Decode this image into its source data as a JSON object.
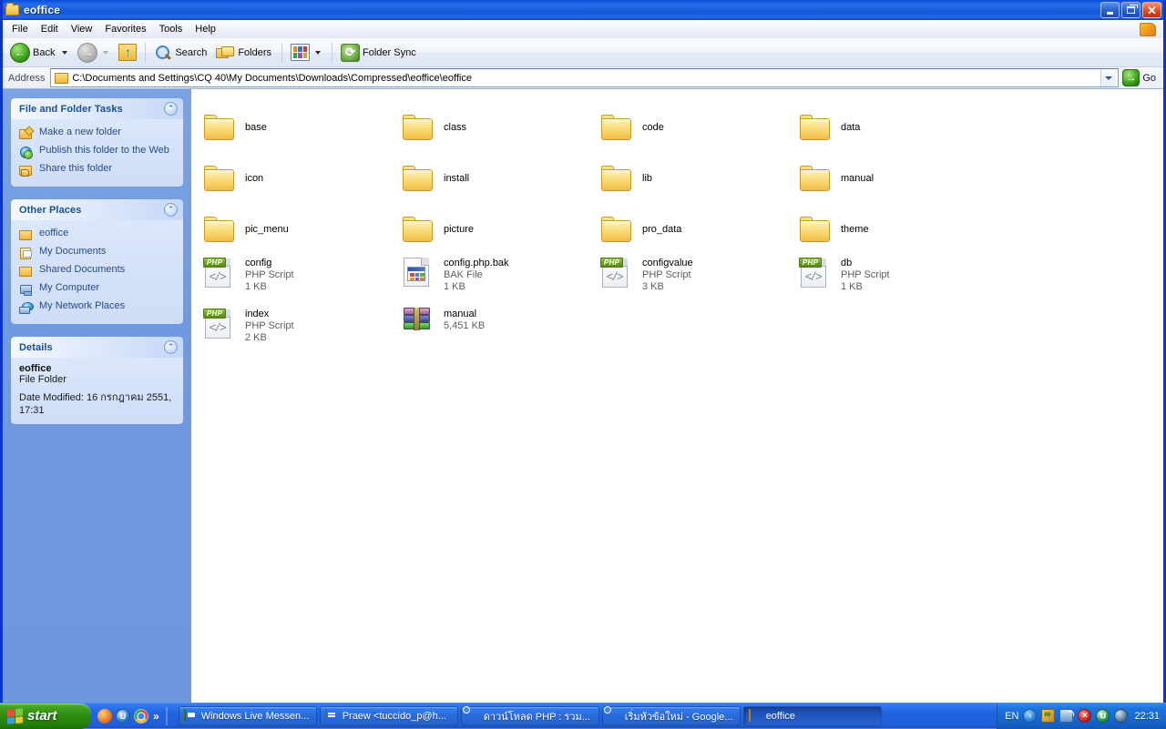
{
  "window": {
    "title": "eoffice",
    "icon": "folder-icon",
    "controls": {
      "minimize": "–",
      "maximize": "❐",
      "close": "✕"
    }
  },
  "menu": {
    "items": [
      "File",
      "Edit",
      "View",
      "Favorites",
      "Tools",
      "Help"
    ]
  },
  "toolbar": {
    "back_label": "Back",
    "search_label": "Search",
    "folders_label": "Folders",
    "folder_sync_label": "Folder Sync"
  },
  "address": {
    "label": "Address",
    "path": "C:\\Documents and Settings\\CQ 40\\My Documents\\Downloads\\Compressed\\eoffice\\eoffice",
    "go_label": "Go"
  },
  "sidebar": {
    "panels": [
      {
        "title": "File and Folder Tasks",
        "toggle": "⌃",
        "items": [
          {
            "label": "Make a new folder",
            "icon": "new-folder-icon"
          },
          {
            "label": "Publish this folder to the Web",
            "icon": "globe-publish-icon"
          },
          {
            "label": "Share this folder",
            "icon": "share-folder-icon"
          }
        ]
      },
      {
        "title": "Other Places",
        "toggle": "⌃",
        "items": [
          {
            "label": "eoffice",
            "icon": "folder-icon"
          },
          {
            "label": "My Documents",
            "icon": "my-documents-icon"
          },
          {
            "label": "Shared Documents",
            "icon": "shared-documents-icon"
          },
          {
            "label": "My Computer",
            "icon": "my-computer-icon"
          },
          {
            "label": "My Network Places",
            "icon": "network-places-icon"
          }
        ]
      }
    ],
    "details": {
      "title": "Details",
      "toggle": "⌃",
      "name": "eoffice",
      "type": "File Folder",
      "date_modified": "Date Modified: 16 กรกฎาคม 2551, 17:31"
    }
  },
  "content": {
    "items": [
      {
        "name": "base",
        "kind": "folder",
        "type": "",
        "size": ""
      },
      {
        "name": "class",
        "kind": "folder",
        "type": "",
        "size": ""
      },
      {
        "name": "code",
        "kind": "folder",
        "type": "",
        "size": ""
      },
      {
        "name": "data",
        "kind": "folder",
        "type": "",
        "size": ""
      },
      {
        "name": "icon",
        "kind": "folder",
        "type": "",
        "size": ""
      },
      {
        "name": "install",
        "kind": "folder",
        "type": "",
        "size": ""
      },
      {
        "name": "lib",
        "kind": "folder",
        "type": "",
        "size": ""
      },
      {
        "name": "manual",
        "kind": "folder",
        "type": "",
        "size": ""
      },
      {
        "name": "pic_menu",
        "kind": "folder",
        "type": "",
        "size": ""
      },
      {
        "name": "picture",
        "kind": "folder",
        "type": "",
        "size": ""
      },
      {
        "name": "pro_data",
        "kind": "folder",
        "type": "",
        "size": ""
      },
      {
        "name": "theme",
        "kind": "folder",
        "type": "",
        "size": ""
      },
      {
        "name": "config",
        "kind": "php",
        "type": "PHP Script",
        "size": "1 KB"
      },
      {
        "name": "config.php.bak",
        "kind": "bak",
        "type": "BAK File",
        "size": "1 KB"
      },
      {
        "name": "configvalue",
        "kind": "php",
        "type": "PHP Script",
        "size": "3 KB"
      },
      {
        "name": "db",
        "kind": "php",
        "type": "PHP Script",
        "size": "1 KB"
      },
      {
        "name": "index",
        "kind": "php",
        "type": "PHP Script",
        "size": "2 KB"
      },
      {
        "name": "manual",
        "kind": "rar",
        "type": "",
        "size": "5,451 KB"
      }
    ],
    "php_badge": "PHP",
    "php_glyph": "</>"
  },
  "taskbar": {
    "start_label": "start",
    "quicklaunch_more": "»",
    "tasks": [
      {
        "label": "Windows Live Messen...",
        "icon": "messenger-icon",
        "active": false
      },
      {
        "label": "Praew <tuccido_p@h...",
        "icon": "message-icon",
        "active": false
      },
      {
        "label": "ดาวน์โหลด PHP : รวม...",
        "icon": "chrome-icon",
        "active": false
      },
      {
        "label": "เริ่มหัวข้อใหม่ - Google...",
        "icon": "chrome-icon",
        "active": false
      },
      {
        "label": "eoffice",
        "icon": "folder-icon",
        "active": true
      }
    ],
    "tray": {
      "language": "EN",
      "chevron": "‹",
      "time": "22:31"
    }
  },
  "colors": {
    "titlebar_blue": "#1157dd",
    "sidebar_blue": "#7ba3e3",
    "panel_header": "#dae6fb",
    "panel_title_text": "#16508f",
    "link_text": "#2a4a86",
    "taskbar_blue": "#2163e0",
    "start_green": "#2f8c12",
    "folder_yellow": "#f8cf62",
    "php_green": "#6f9f22"
  }
}
